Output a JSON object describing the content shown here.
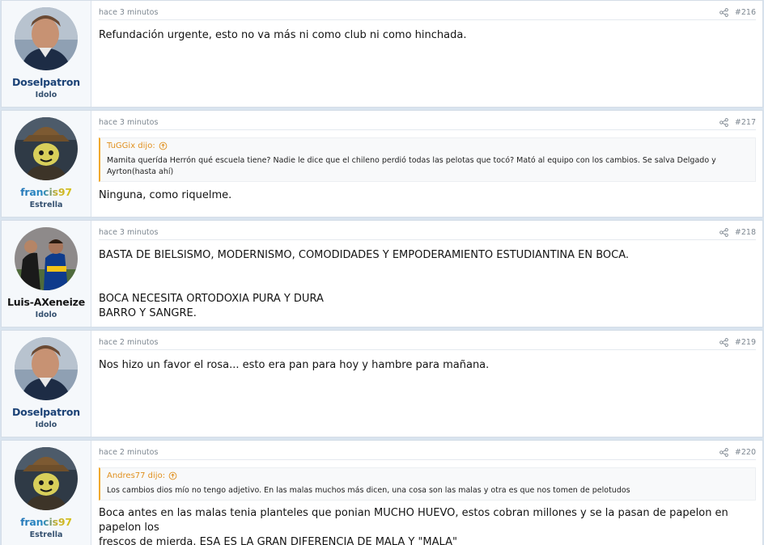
{
  "posts": [
    {
      "username": "Doselpatron",
      "user_title": "Idolo",
      "time": "hace 3 minutos",
      "number": "#216",
      "avatar": "coach-photo",
      "lines": [
        "Refundación urgente, esto no va más ni como club ni como hinchada."
      ]
    },
    {
      "username": "francis97",
      "user_title": "Estrella",
      "time": "hace 3 minutos",
      "number": "#217",
      "avatar": "hat-character",
      "quote": {
        "author": "TuGGix dijo:",
        "text": "Mamita querída Herrón qué escuela tiene? Nadie le dice que el chileno perdió todas las pelotas que tocó? Mató al equipo con los cambios. Se salva Delgado y Ayrton(hasta ahí)"
      },
      "lines": [
        "Ninguna, como riquelme."
      ]
    },
    {
      "username": "Luis-AXeneize",
      "user_title": "Idolo",
      "time": "hace 3 minutos",
      "number": "#218",
      "avatar": "players-photo",
      "lines": [
        "BASTA DE BIELSISMO, MODERNISMO, COMODIDADES Y EMPODERAMIENTO ESTUDIANTINA EN BOCA.",
        "",
        "BOCA NECESITA ORTODOXIA PURA Y DURA",
        "BARRO Y SANGRE."
      ]
    },
    {
      "username": "Doselpatron",
      "user_title": "Idolo",
      "time": "hace 2 minutos",
      "number": "#219",
      "avatar": "coach-photo",
      "lines": [
        "Nos hizo un favor el rosa... esto era pan para hoy y hambre para mañana."
      ]
    },
    {
      "username": "francis97",
      "user_title": "Estrella",
      "time": "hace 2 minutos",
      "number": "#220",
      "avatar": "hat-character",
      "quote": {
        "author": "Andres77 dijo:",
        "text": "Los cambios dios mío no tengo adjetivo. En las malas muchos más dicen, una cosa son las malas y otra es que nos tomen de pelotudos"
      },
      "lines": [
        "Boca antes en las malas tenia planteles que ponian MUCHO HUEVO, estos cobran millones y se la pasan de papelon en papelon los",
        "frescos de mierda. ESA ES LA GRAN DIFERENCIA DE MALA Y \"MALA\""
      ]
    }
  ],
  "colors": {
    "username_blue": "#1b4276",
    "quote_accent": "#f0a92e",
    "meta_gray": "#7d8791"
  }
}
